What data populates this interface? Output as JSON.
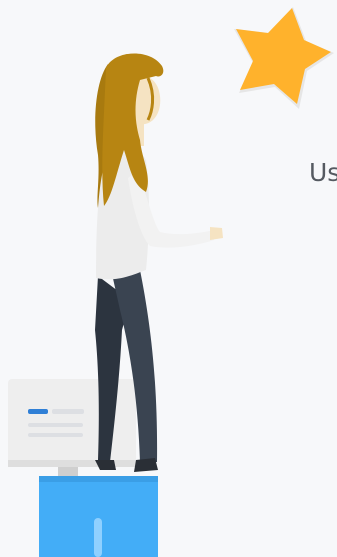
{
  "visible_text": {
    "partial_label": "Us"
  },
  "colors": {
    "background": "#f7f8fa",
    "star_fill": "#ffb22c",
    "pedestal_blue": "#43adf7",
    "hair": "#b78512",
    "pants": "#3a4451",
    "shirt": "#ececec",
    "skin": "#f5e3c2",
    "monitor_body": "#eeeeee",
    "monitor_accent": "#2f7fd6",
    "text_gray": "#555a61"
  },
  "icons": {
    "star": "star-icon"
  }
}
